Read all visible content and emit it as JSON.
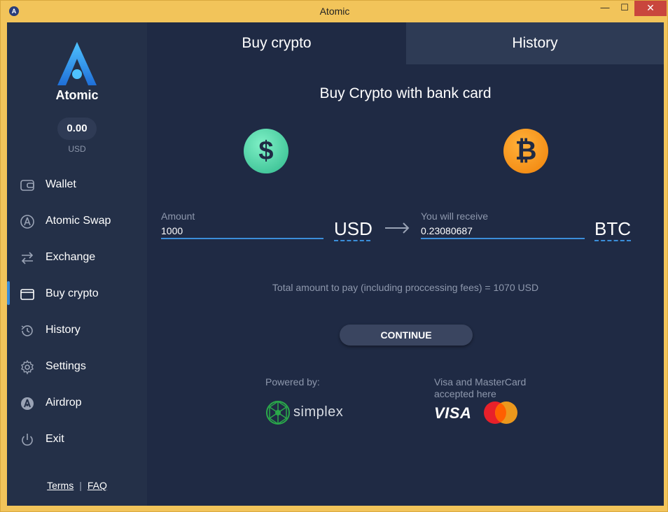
{
  "window": {
    "title": "Atomic",
    "minimize": "—",
    "maximize": "☐",
    "close": "✕"
  },
  "sidebar": {
    "logo_text": "Atomic",
    "balance": "0.00",
    "balance_currency": "USD",
    "items": [
      {
        "label": "Wallet",
        "icon": "wallet-icon"
      },
      {
        "label": "Atomic Swap",
        "icon": "atomic-swap-icon"
      },
      {
        "label": "Exchange",
        "icon": "exchange-icon"
      },
      {
        "label": "Buy crypto",
        "icon": "card-icon",
        "active": true
      },
      {
        "label": "History",
        "icon": "history-icon"
      },
      {
        "label": "Settings",
        "icon": "gear-icon"
      },
      {
        "label": "Airdrop",
        "icon": "airdrop-icon"
      },
      {
        "label": "Exit",
        "icon": "power-icon"
      }
    ],
    "terms": "Terms",
    "faq": "FAQ"
  },
  "tabs": {
    "buy": "Buy crypto",
    "history": "History"
  },
  "main": {
    "heading": "Buy Crypto with bank card",
    "amount_label": "Amount",
    "amount_value": "1000",
    "from_currency": "USD",
    "receive_label": "You will receive",
    "receive_value": "0.23080687",
    "to_currency": "BTC",
    "total": "Total amount to pay (including proccessing fees) = 1070 USD",
    "continue": "CONTINUE",
    "powered_by": "Powered by:",
    "simplex": "simplex",
    "accepted": "Visa and MasterCard accepted here",
    "visa": "VISA"
  },
  "colors": {
    "accent": "#3b8ed9",
    "bg": "#1f2a44",
    "sidebar": "#243048",
    "window_frame": "#f2c45a"
  }
}
